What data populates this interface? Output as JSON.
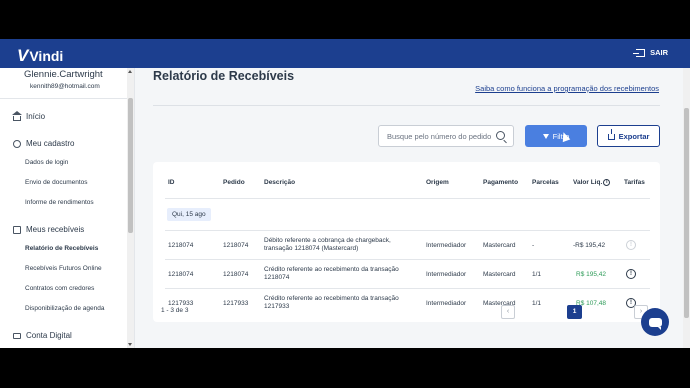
{
  "app": {
    "brand": "Vindi",
    "logout_label": "SAIR"
  },
  "user": {
    "name": "Glennie.Cartwright",
    "email": "kennith89@hotmail.com"
  },
  "sidebar": {
    "home": "Início",
    "cadastro_title": "Meu cadastro",
    "cadastro_items": [
      "Dados de login",
      "Envio de documentos",
      "Informe de rendimentos"
    ],
    "recebiveis_title": "Meus recebíveis",
    "recebiveis_items": [
      "Relatório de Recebíveis",
      "Recebíveis Futuros Online",
      "Contratos com credores",
      "Disponibilização de agenda"
    ],
    "conta_title": "Conta Digital"
  },
  "page": {
    "title": "Relatório de Recebíveis",
    "help_link": "Saiba como funciona a programação dos recebimentos",
    "search_placeholder": "Busque pelo número do pedido",
    "filter_label": "Filtro",
    "export_label": "Exportar"
  },
  "table": {
    "headers": [
      "ID",
      "Pedido",
      "Descrição",
      "Origem",
      "Pagamento",
      "Parcelas",
      "Valor Liq.",
      "Tarifas"
    ],
    "date_group": "Qui, 15 ago",
    "rows": [
      {
        "id": "1218074",
        "pedido": "1218074",
        "descricao": "Débito referente a cobrança de chargeback, transação 1218074 (Mastercard)",
        "origem": "Intermediador",
        "pagamento": "Mastercard",
        "parcelas": "-",
        "valor": "-R$ 195,42",
        "sign": "neg",
        "tarifa_enabled": false
      },
      {
        "id": "1218074",
        "pedido": "1218074",
        "descricao": "Crédito referente ao recebimento da transação 1218074",
        "origem": "Intermediador",
        "pagamento": "Mastercard",
        "parcelas": "1/1",
        "valor": "R$ 195,42",
        "sign": "pos",
        "tarifa_enabled": true
      },
      {
        "id": "1217933",
        "pedido": "1217933",
        "descricao": "Crédito referente ao recebimento da transação 1217933",
        "origem": "Intermediador",
        "pagamento": "Mastercard",
        "parcelas": "1/1",
        "valor": "R$ 107,48",
        "sign": "pos",
        "tarifa_enabled": true
      }
    ]
  },
  "pagination": {
    "count": "1 - 3 de 3",
    "current_page": "1",
    "prev": "‹",
    "next": "›"
  },
  "colors": {
    "brand": "#1c3f8f",
    "accent": "#4a7fe0",
    "positive": "#2e9b58"
  }
}
